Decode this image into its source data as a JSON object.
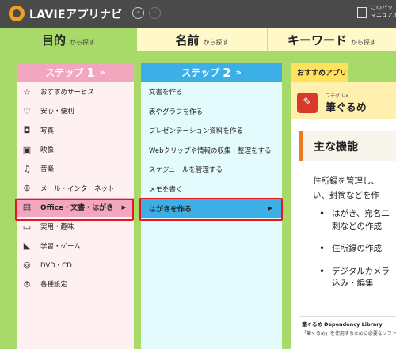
{
  "header": {
    "app_title": "LAVIEアプリナビ",
    "back_icon": "‹",
    "forward_icon": "›",
    "manual_label": "このパソコン\nマニュアル"
  },
  "tabs": [
    {
      "main": "目的",
      "sub": "から探す"
    },
    {
      "main": "名前",
      "sub": "から探す"
    },
    {
      "main": "キーワード",
      "sub": "から探す"
    }
  ],
  "step1": {
    "label": "ステップ",
    "number": "1",
    "chevron": "»",
    "items": [
      {
        "icon": "☆",
        "label": "おすすめサービス"
      },
      {
        "icon": "♡",
        "label": "安心・便利"
      },
      {
        "icon": "◘",
        "label": "写真"
      },
      {
        "icon": "▣",
        "label": "映像"
      },
      {
        "icon": "♫",
        "label": "音楽"
      },
      {
        "icon": "⊕",
        "label": "メール・インターネット"
      },
      {
        "icon": "▤",
        "label": "Office・文書・はがき",
        "arrow": "▶"
      },
      {
        "icon": "▭",
        "label": "実用・趣味"
      },
      {
        "icon": "◣",
        "label": "学習・ゲーム"
      },
      {
        "icon": "◎",
        "label": "DVD・CD"
      },
      {
        "icon": "⚙",
        "label": "各種設定"
      }
    ]
  },
  "step2": {
    "label": "ステップ",
    "number": "2",
    "chevron": "»",
    "items": [
      {
        "label": "文書を作る"
      },
      {
        "label": "表やグラフを作る"
      },
      {
        "label": "プレゼンテーション資料を作る"
      },
      {
        "label": "Webクリップや情報の収集・整理をする"
      },
      {
        "label": "スケジュールを管理する"
      },
      {
        "label": "メモを書く"
      },
      {
        "label": "はがきを作る",
        "arrow": "▶"
      }
    ]
  },
  "recommend": {
    "tab_label": "おすすめアプリ",
    "app_sub": "フデグルメ",
    "app_name": "筆ぐるめ",
    "features_title": "主な機能",
    "desc_line1": "住所録を管理し、",
    "desc_line2": "い、封筒などを作",
    "bullets": [
      "はがき、宛名二\n刺などの作成",
      "住所録の作成",
      "デジタルカメラ\n込み・編集"
    ],
    "dep_title": "筆ぐるめ Dependency Library",
    "dep_text": "「筆ぐるめ」を使用するために必要なソフトウ"
  }
}
